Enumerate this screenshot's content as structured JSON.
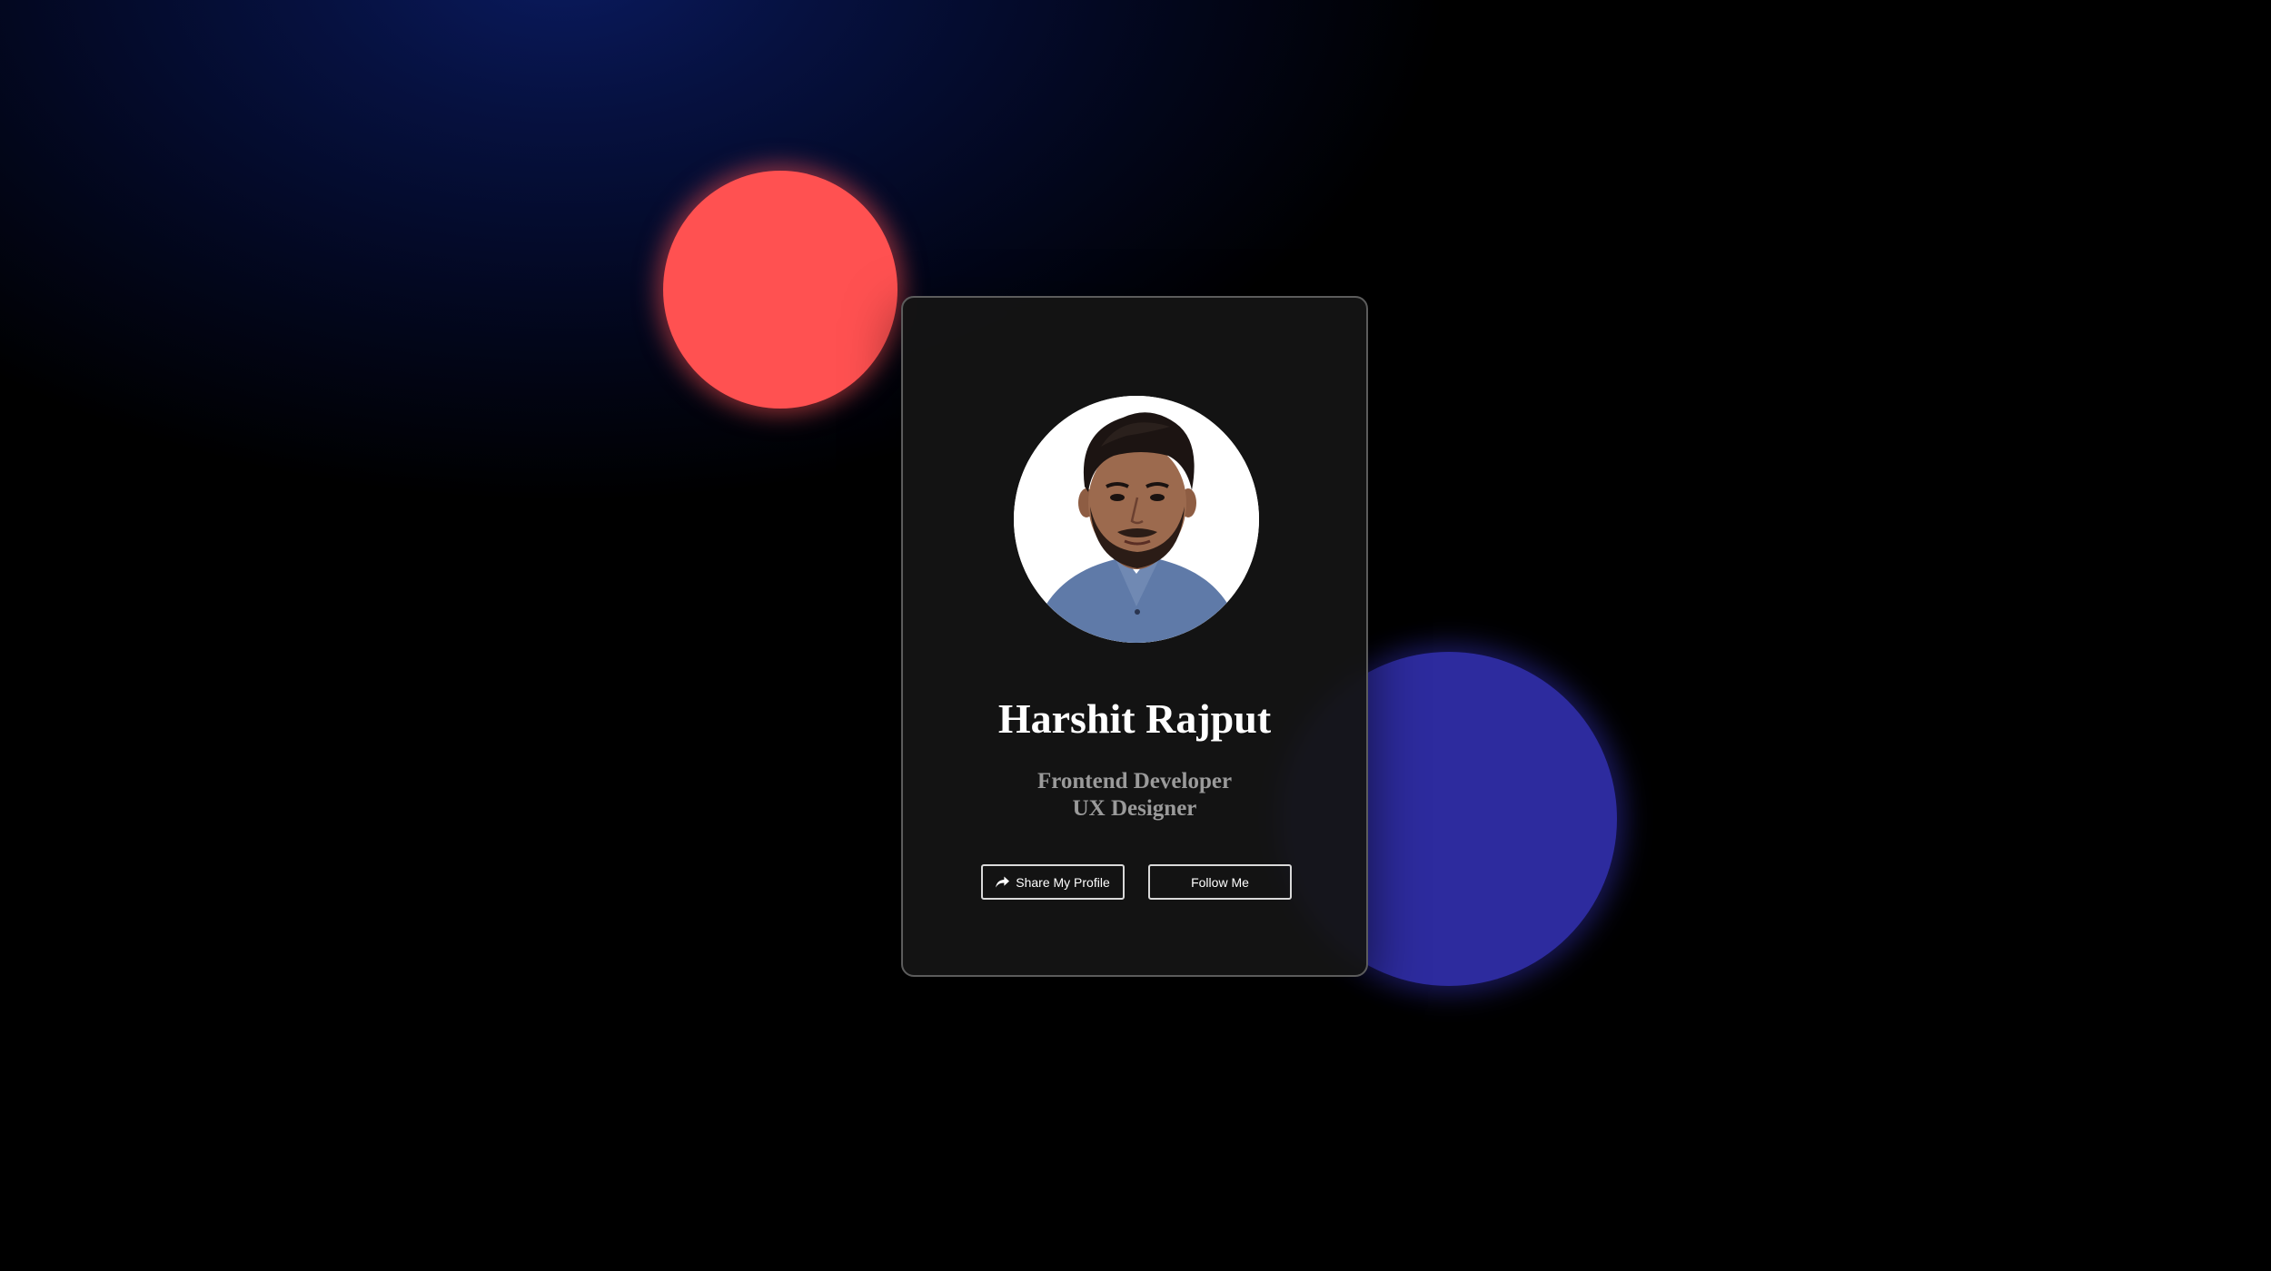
{
  "profile": {
    "name": "Harshit Rajput",
    "roles": [
      "Frontend Developer",
      "UX Designer"
    ]
  },
  "actions": {
    "share_label": "Share My Profile",
    "share_icon": "share-icon",
    "follow_label": "Follow Me"
  },
  "colors": {
    "red_blob": "#ff5151",
    "blue_blob": "#2d2b9e",
    "card_bg": "#141414",
    "name_text": "#ffffff",
    "role_text": "#9a9a9a"
  }
}
